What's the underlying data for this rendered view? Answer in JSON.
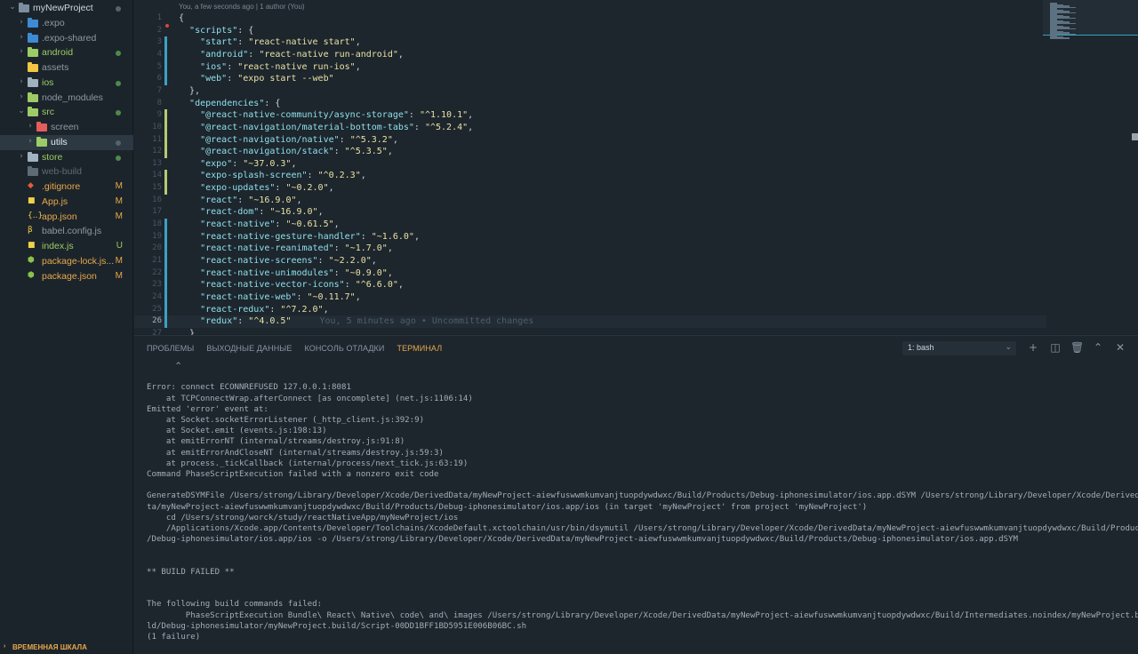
{
  "sidebar": {
    "items": [
      {
        "label": "myNewProject",
        "kind": "folder-open",
        "color": "#cfd6dd",
        "folder_color": "#7b8ea0",
        "status": "dot-gray",
        "depth": 0,
        "chevron": "down"
      },
      {
        "label": ".expo",
        "kind": "folder-special",
        "color": "#8f99a3",
        "folder_color": "#3d8bd4",
        "status": "",
        "depth": 1,
        "chevron": "right"
      },
      {
        "label": ".expo-shared",
        "kind": "folder-special",
        "color": "#8f99a3",
        "folder_color": "#3d8bd4",
        "status": "",
        "depth": 1,
        "chevron": "right"
      },
      {
        "label": "android",
        "kind": "folder",
        "color": "#9ccc65",
        "folder_color": "#9ccc65",
        "status": "dot-green",
        "depth": 1,
        "chevron": "right"
      },
      {
        "label": "assets",
        "kind": "folder",
        "color": "#8f99a3",
        "folder_color": "#f4c542",
        "status": "",
        "depth": 1,
        "chevron": ""
      },
      {
        "label": "ios",
        "kind": "folder",
        "color": "#9ccc65",
        "folder_color": "#9fb2c0",
        "status": "dot-green",
        "depth": 1,
        "chevron": "right"
      },
      {
        "label": "node_modules",
        "kind": "folder",
        "color": "#8f99a3",
        "folder_color": "#9ccc65",
        "status": "",
        "depth": 1,
        "chevron": "right"
      },
      {
        "label": "src",
        "kind": "folder",
        "color": "#9ccc65",
        "folder_color": "#9ccc65",
        "status": "dot-green",
        "depth": 1,
        "chevron": "down"
      },
      {
        "label": "screen",
        "kind": "folder",
        "color": "#8f99a3",
        "folder_color": "#e35d5b",
        "status": "",
        "depth": 2,
        "chevron": "right"
      },
      {
        "label": "utils",
        "kind": "folder",
        "color": "#e6ecf0",
        "folder_color": "#9ccc65",
        "status": "dot-gray",
        "depth": 2,
        "chevron": "right",
        "selected": true
      },
      {
        "label": "store",
        "kind": "folder",
        "color": "#9ccc65",
        "folder_color": "#9fb2c0",
        "status": "dot-green",
        "depth": 1,
        "chevron": "right"
      },
      {
        "label": "web-build",
        "kind": "folder",
        "color": "#5f6a75",
        "folder_color": "#5f6a75",
        "status": "",
        "depth": 1,
        "chevron": ""
      },
      {
        "label": ".gitignore",
        "kind": "file",
        "icon": "git-file-icon",
        "glyph": "◆",
        "icon_color": "#e35d3a",
        "color": "#e8a84b",
        "status": "M",
        "status_color": "#e8a84b",
        "depth": 1
      },
      {
        "label": "App.js",
        "kind": "file",
        "icon": "js-file-icon",
        "glyph": "■",
        "icon_color": "#f0d24a",
        "color": "#e8a84b",
        "status": "M",
        "status_color": "#e8a84b",
        "depth": 1
      },
      {
        "label": "app.json",
        "kind": "file",
        "icon": "json-file-icon",
        "glyph": "{..}",
        "icon_color": "#f0d24a",
        "color": "#e8a84b",
        "status": "M",
        "status_color": "#e8a84b",
        "depth": 1
      },
      {
        "label": "babel.config.js",
        "kind": "file",
        "icon": "babel-file-icon",
        "glyph": "β",
        "icon_color": "#f0d24a",
        "color": "#8f99a3",
        "status": "",
        "depth": 1
      },
      {
        "label": "index.js",
        "kind": "file",
        "icon": "js-file-icon",
        "glyph": "■",
        "icon_color": "#f0d24a",
        "color": "#9ccc65",
        "status": "U",
        "status_color": "#9ccc65",
        "depth": 1
      },
      {
        "label": "package-lock.js...",
        "kind": "file",
        "icon": "npm-file-icon",
        "glyph": "⬢",
        "icon_color": "#8bc34a",
        "color": "#e8a84b",
        "status": "M",
        "status_color": "#e8a84b",
        "depth": 1
      },
      {
        "label": "package.json",
        "kind": "file",
        "icon": "npm-file-icon",
        "glyph": "⬢",
        "icon_color": "#8bc34a",
        "color": "#e8a84b",
        "status": "M",
        "status_color": "#e8a84b",
        "depth": 1
      }
    ],
    "timeline_label": "ВРЕМЕННАЯ ШКАЛА"
  },
  "editor": {
    "blame_header": "You, a few seconds ago | 1 author (You)",
    "lines": [
      {
        "n": "1",
        "g": "",
        "t": [
          [
            "p",
            "{"
          ]
        ]
      },
      {
        "n": "2",
        "g": "",
        "t": [
          [
            "p",
            "  "
          ],
          [
            "k",
            "\"scripts\""
          ],
          [
            "p",
            ": {"
          ]
        ]
      },
      {
        "n": "3",
        "g": "mod",
        "t": [
          [
            "p",
            "    "
          ],
          [
            "k",
            "\"start\""
          ],
          [
            "p",
            ": "
          ],
          [
            "s",
            "\"react-native start\""
          ],
          [
            "p",
            ","
          ]
        ]
      },
      {
        "n": "4",
        "g": "mod",
        "t": [
          [
            "p",
            "    "
          ],
          [
            "k",
            "\"android\""
          ],
          [
            "p",
            ": "
          ],
          [
            "s",
            "\"react-native run-android\""
          ],
          [
            "p",
            ","
          ]
        ]
      },
      {
        "n": "5",
        "g": "mod",
        "t": [
          [
            "p",
            "    "
          ],
          [
            "k",
            "\"ios\""
          ],
          [
            "p",
            ": "
          ],
          [
            "s",
            "\"react-native run-ios\""
          ],
          [
            "p",
            ","
          ]
        ]
      },
      {
        "n": "6",
        "g": "mod",
        "t": [
          [
            "p",
            "    "
          ],
          [
            "k",
            "\"web\""
          ],
          [
            "p",
            ": "
          ],
          [
            "s",
            "\"expo start --web\""
          ]
        ]
      },
      {
        "n": "7",
        "g": "",
        "t": [
          [
            "p",
            "  },"
          ]
        ]
      },
      {
        "n": "8",
        "g": "",
        "t": [
          [
            "p",
            "  "
          ],
          [
            "k",
            "\"dependencies\""
          ],
          [
            "p",
            ": {"
          ]
        ]
      },
      {
        "n": "9",
        "g": "add",
        "t": [
          [
            "p",
            "    "
          ],
          [
            "k",
            "\"@react-native-community/async-storage\""
          ],
          [
            "p",
            ": "
          ],
          [
            "s",
            "\"^1.10.1\""
          ],
          [
            "p",
            ","
          ]
        ]
      },
      {
        "n": "10",
        "g": "add",
        "t": [
          [
            "p",
            "    "
          ],
          [
            "k",
            "\"@react-navigation/material-bottom-tabs\""
          ],
          [
            "p",
            ": "
          ],
          [
            "s",
            "\"^5.2.4\""
          ],
          [
            "p",
            ","
          ]
        ]
      },
      {
        "n": "11",
        "g": "add",
        "t": [
          [
            "p",
            "    "
          ],
          [
            "k",
            "\"@react-navigation/native\""
          ],
          [
            "p",
            ": "
          ],
          [
            "s",
            "\"^5.3.2\""
          ],
          [
            "p",
            ","
          ]
        ]
      },
      {
        "n": "12",
        "g": "add",
        "t": [
          [
            "p",
            "    "
          ],
          [
            "k",
            "\"@react-navigation/stack\""
          ],
          [
            "p",
            ": "
          ],
          [
            "s",
            "\"^5.3.5\""
          ],
          [
            "p",
            ","
          ]
        ]
      },
      {
        "n": "13",
        "g": "",
        "t": [
          [
            "p",
            "    "
          ],
          [
            "k",
            "\"expo\""
          ],
          [
            "p",
            ": "
          ],
          [
            "s",
            "\"~37.0.3\""
          ],
          [
            "p",
            ","
          ]
        ]
      },
      {
        "n": "14",
        "g": "add",
        "t": [
          [
            "p",
            "    "
          ],
          [
            "k",
            "\"expo-splash-screen\""
          ],
          [
            "p",
            ": "
          ],
          [
            "s",
            "\"^0.2.3\""
          ],
          [
            "p",
            ","
          ]
        ]
      },
      {
        "n": "15",
        "g": "add",
        "t": [
          [
            "p",
            "    "
          ],
          [
            "k",
            "\"expo-updates\""
          ],
          [
            "p",
            ": "
          ],
          [
            "s",
            "\"~0.2.0\""
          ],
          [
            "p",
            ","
          ]
        ]
      },
      {
        "n": "16",
        "g": "",
        "t": [
          [
            "p",
            "    "
          ],
          [
            "k",
            "\"react\""
          ],
          [
            "p",
            ": "
          ],
          [
            "s",
            "\"~16.9.0\""
          ],
          [
            "p",
            ","
          ]
        ]
      },
      {
        "n": "17",
        "g": "",
        "t": [
          [
            "p",
            "    "
          ],
          [
            "k",
            "\"react-dom\""
          ],
          [
            "p",
            ": "
          ],
          [
            "s",
            "\"~16.9.0\""
          ],
          [
            "p",
            ","
          ]
        ]
      },
      {
        "n": "18",
        "g": "mod",
        "t": [
          [
            "p",
            "    "
          ],
          [
            "k",
            "\"react-native\""
          ],
          [
            "p",
            ": "
          ],
          [
            "s",
            "\"~0.61.5\""
          ],
          [
            "p",
            ","
          ]
        ]
      },
      {
        "n": "19",
        "g": "mod",
        "t": [
          [
            "p",
            "    "
          ],
          [
            "k",
            "\"react-native-gesture-handler\""
          ],
          [
            "p",
            ": "
          ],
          [
            "s",
            "\"~1.6.0\""
          ],
          [
            "p",
            ","
          ]
        ]
      },
      {
        "n": "20",
        "g": "mod",
        "t": [
          [
            "p",
            "    "
          ],
          [
            "k",
            "\"react-native-reanimated\""
          ],
          [
            "p",
            ": "
          ],
          [
            "s",
            "\"~1.7.0\""
          ],
          [
            "p",
            ","
          ]
        ]
      },
      {
        "n": "21",
        "g": "mod",
        "t": [
          [
            "p",
            "    "
          ],
          [
            "k",
            "\"react-native-screens\""
          ],
          [
            "p",
            ": "
          ],
          [
            "s",
            "\"~2.2.0\""
          ],
          [
            "p",
            ","
          ]
        ]
      },
      {
        "n": "22",
        "g": "mod",
        "t": [
          [
            "p",
            "    "
          ],
          [
            "k",
            "\"react-native-unimodules\""
          ],
          [
            "p",
            ": "
          ],
          [
            "s",
            "\"~0.9.0\""
          ],
          [
            "p",
            ","
          ]
        ]
      },
      {
        "n": "23",
        "g": "mod",
        "t": [
          [
            "p",
            "    "
          ],
          [
            "k",
            "\"react-native-vector-icons\""
          ],
          [
            "p",
            ": "
          ],
          [
            "s",
            "\"^6.6.0\""
          ],
          [
            "p",
            ","
          ]
        ]
      },
      {
        "n": "24",
        "g": "mod",
        "t": [
          [
            "p",
            "    "
          ],
          [
            "k",
            "\"react-native-web\""
          ],
          [
            "p",
            ": "
          ],
          [
            "s",
            "\"~0.11.7\""
          ],
          [
            "p",
            ","
          ]
        ]
      },
      {
        "n": "25",
        "g": "mod",
        "t": [
          [
            "p",
            "    "
          ],
          [
            "k",
            "\"react-redux\""
          ],
          [
            "p",
            ": "
          ],
          [
            "s",
            "\"^7.2.0\""
          ],
          [
            "p",
            ","
          ]
        ]
      },
      {
        "n": "26",
        "g": "mod",
        "active": true,
        "t": [
          [
            "p",
            "    "
          ],
          [
            "k",
            "\"redux\""
          ],
          [
            "p",
            ": "
          ],
          [
            "s",
            "\"^4.0.5\""
          ]
        ],
        "inline_blame": "You, 5 minutes ago • Uncommitted changes"
      },
      {
        "n": "27",
        "g": "",
        "t": [
          [
            "p",
            "  }"
          ]
        ]
      }
    ]
  },
  "panel": {
    "tabs": [
      {
        "label": "ПРОБЛЕМЫ",
        "active": false
      },
      {
        "label": "ВЫХОДНЫЕ ДАННЫЕ",
        "active": false
      },
      {
        "label": "КОНСОЛЬ ОТЛАДКИ",
        "active": false
      },
      {
        "label": "ТЕРМИНАЛ",
        "active": true
      }
    ],
    "terminal_select": "1: bash",
    "terminal_text": "      ^\n\nError: connect ECONNREFUSED 127.0.0.1:8081\n    at TCPConnectWrap.afterConnect [as oncomplete] (net.js:1106:14)\nEmitted 'error' event at:\n    at Socket.socketErrorListener (_http_client.js:392:9)\n    at Socket.emit (events.js:198:13)\n    at emitErrorNT (internal/streams/destroy.js:91:8)\n    at emitErrorAndCloseNT (internal/streams/destroy.js:59:3)\n    at process._tickCallback (internal/process/next_tick.js:63:19)\nCommand PhaseScriptExecution failed with a nonzero exit code\n\nGenerateDSYMFile /Users/strong/Library/Developer/Xcode/DerivedData/myNewProject-aiewfuswwmkumvanjtuopdywdwxc/Build/Products/Debug-iphonesimulator/ios.app.dSYM /Users/strong/Library/Developer/Xcode/DerivedDa\nta/myNewProject-aiewfuswwmkumvanjtuopdywdwxc/Build/Products/Debug-iphonesimulator/ios.app/ios (in target 'myNewProject' from project 'myNewProject')\n    cd /Users/strong/worck/study/reactNativeApp/myNewProject/ios\n    /Applications/Xcode.app/Contents/Developer/Toolchains/XcodeDefault.xctoolchain/usr/bin/dsymutil /Users/strong/Library/Developer/Xcode/DerivedData/myNewProject-aiewfuswwmkumvanjtuopdywdwxc/Build/Products\n/Debug-iphonesimulator/ios.app/ios -o /Users/strong/Library/Developer/Xcode/DerivedData/myNewProject-aiewfuswwmkumvanjtuopdywdwxc/Build/Products/Debug-iphonesimulator/ios.app.dSYM\n\n\n** BUILD FAILED **\n\n\nThe following build commands failed:\n        PhaseScriptExecution Bundle\\ React\\ Native\\ code\\ and\\ images /Users/strong/Library/Developer/Xcode/DerivedData/myNewProject-aiewfuswwmkumvanjtuopdywdwxc/Build/Intermediates.noindex/myNewProject.bui\nld/Debug-iphonesimulator/myNewProject.build/Script-00DD1BFF1BD5951E006B06BC.sh\n(1 failure)"
  }
}
